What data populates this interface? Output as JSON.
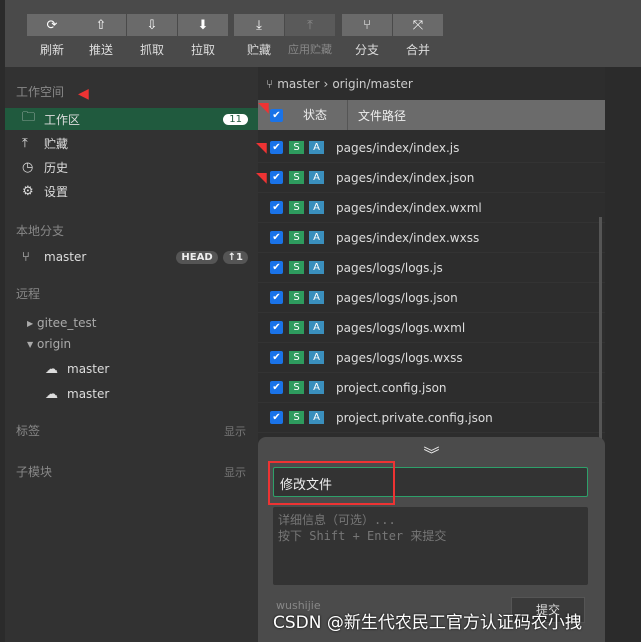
{
  "toolbar": {
    "refresh": "刷新",
    "push": "推送",
    "fetch": "抓取",
    "pull": "拉取",
    "stash": "贮藏",
    "apply_stash": "应用贮藏",
    "branch": "分支",
    "merge": "合并"
  },
  "sidebar": {
    "workspace_title": "工作空间",
    "items": [
      {
        "label": "工作区",
        "count": "11"
      },
      {
        "label": "贮藏"
      },
      {
        "label": "历史"
      },
      {
        "label": "设置"
      }
    ],
    "local_title": "本地分支",
    "local_branch": "master",
    "head_badge": "HEAD",
    "ahead_badge": "↑1",
    "remote_title": "远程",
    "remotes": [
      "gitee_test",
      "origin"
    ],
    "origin_branches": [
      "master",
      "master"
    ],
    "tags_title": "标签",
    "submodules_title": "子模块",
    "show_label": "显示"
  },
  "main": {
    "branch": "master",
    "upstream": "origin/master",
    "col_status": "状态",
    "col_path": "文件路径",
    "files": [
      "pages/index/index.js",
      "pages/index/index.json",
      "pages/index/index.wxml",
      "pages/index/index.wxss",
      "pages/logs/logs.js",
      "pages/logs/logs.json",
      "pages/logs/logs.wxml",
      "pages/logs/logs.wxss",
      "project.config.json",
      "project.private.config.json"
    ],
    "s_badge": "S",
    "a_badge": "A"
  },
  "commit": {
    "summary": "修改文件",
    "description_placeholder": "详细信息（可选）...\n按下 Shift + Enter 来提交",
    "author": "wushijie",
    "submit": "提交"
  },
  "watermark": "CSDN @新生代农民工官方认证码农小拽"
}
